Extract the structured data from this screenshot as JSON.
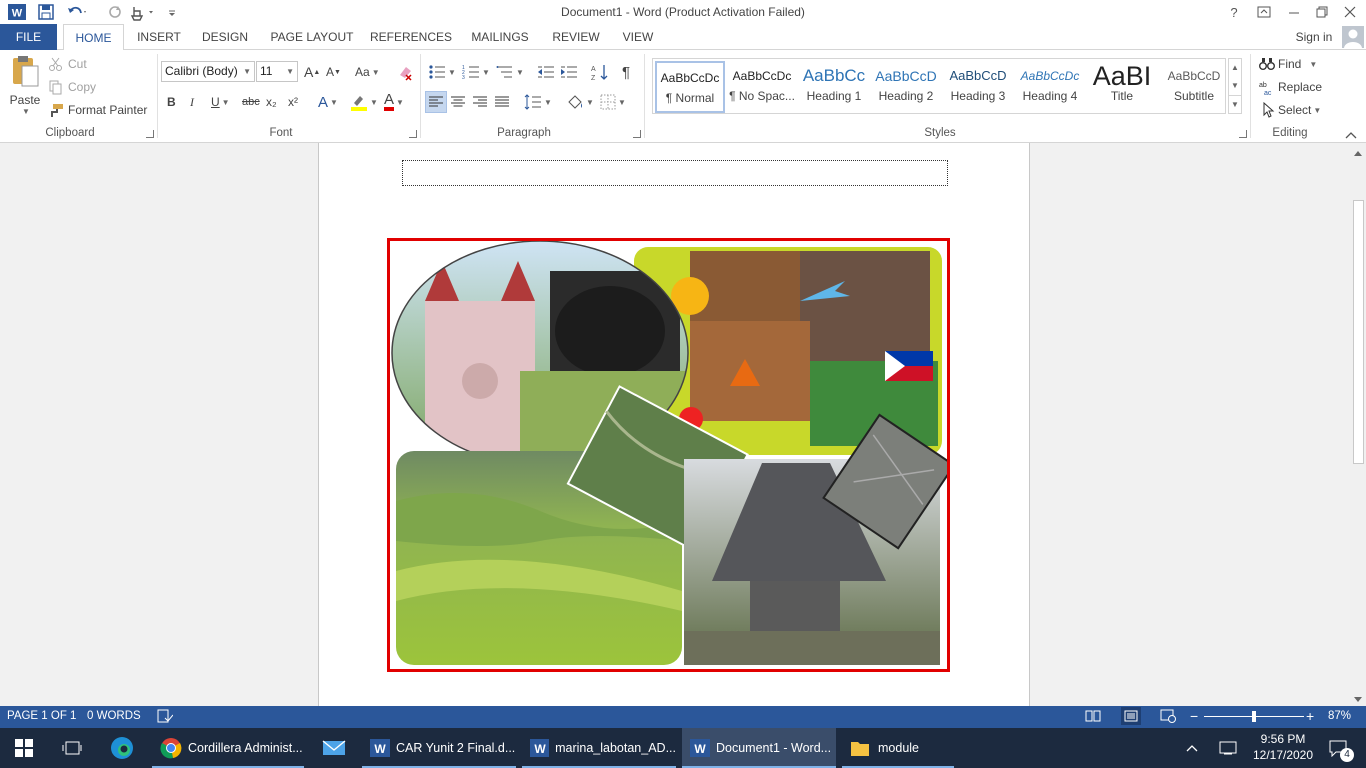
{
  "window": {
    "title": "Document1 - Word (Product Activation Failed)",
    "controls": {
      "help": "?",
      "restore_ribbon": "⧉",
      "minimize": "—",
      "maximize": "❐",
      "close": "✕"
    }
  },
  "quick_access": {
    "app_icon": "word-icon",
    "save": "save-icon",
    "undo": "undo-icon",
    "redo": "redo-icon",
    "touch": "touch-mode-icon",
    "customize": "customize-icon"
  },
  "tabs": {
    "file": "FILE",
    "items": [
      "HOME",
      "INSERT",
      "DESIGN",
      "PAGE LAYOUT",
      "REFERENCES",
      "MAILINGS",
      "REVIEW",
      "VIEW"
    ],
    "active": "HOME",
    "sign_in": "Sign in"
  },
  "clipboard": {
    "paste": "Paste",
    "cut": "Cut",
    "copy": "Copy",
    "format_painter": "Format Painter",
    "label": "Clipboard"
  },
  "font": {
    "family": "Calibri (Body)",
    "size": "11",
    "grow": "A",
    "shrink": "A",
    "change_case": "Aa",
    "bold": "B",
    "italic": "I",
    "underline": "U",
    "strikethrough": "abc",
    "subscript": "x₂",
    "superscript": "x²",
    "text_effects": "A",
    "font_color": "A",
    "label": "Font"
  },
  "paragraph": {
    "label": "Paragraph"
  },
  "styles": {
    "label": "Styles",
    "items": [
      {
        "preview": "AaBbCcDc",
        "name": "¶ Normal"
      },
      {
        "preview": "AaBbCcDc",
        "name": "¶ No Spac..."
      },
      {
        "preview": "AaBbCc",
        "name": "Heading 1"
      },
      {
        "preview": "AaBbCcD",
        "name": "Heading 2"
      },
      {
        "preview": "AaBbCcD",
        "name": "Heading 3"
      },
      {
        "preview": "AaBbCcDc",
        "name": "Heading 4"
      },
      {
        "preview": "AaBI",
        "name": "Title"
      },
      {
        "preview": "AaBbCcD",
        "name": "Subtitle"
      }
    ]
  },
  "editing": {
    "find": "Find",
    "replace": "Replace",
    "select": "Select",
    "label": "Editing"
  },
  "status": {
    "page": "PAGE 1 OF 1",
    "words": "0 WORDS",
    "zoom": "87%",
    "zoom_fraction": 0.5
  },
  "taskbar": {
    "apps": [
      {
        "label": "Cordillera Administ...",
        "icon": "chrome-icon"
      },
      {
        "label": "CAR Yunit 2 Final.d...",
        "icon": "word-icon"
      },
      {
        "label": "marina_labotan_AD...",
        "icon": "word-icon"
      },
      {
        "label": "Document1 - Word...",
        "icon": "word-icon"
      },
      {
        "label": "module",
        "icon": "folder-icon"
      }
    ],
    "time": "9:56 PM",
    "date": "12/17/2020",
    "notifications": "4"
  },
  "colors": {
    "accent": "#2b579a",
    "picture_border": "#e10000",
    "taskbar": "#1c2a3f"
  }
}
